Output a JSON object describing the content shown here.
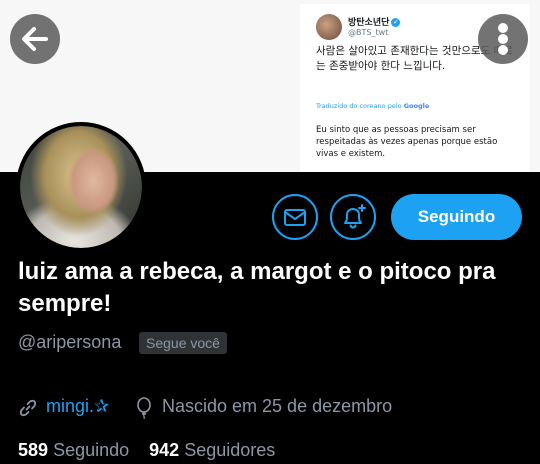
{
  "header_tweet": {
    "author_name": "방탄소년단",
    "author_handle": "@BTS_twt",
    "korean_text": "사람은 살아있고 존재한다는 것만으로도 때로는 존중받아야 한다 느낍니다.",
    "translated_label": "Traduzido do coreano pelo",
    "translated_brand": "Google",
    "portuguese_text": "Eu sinto que as pessoas precisam ser respeitadas às vezes apenas porque estão vivas e existem."
  },
  "nav": {
    "back_icon": "arrow-left-icon",
    "more_icon": "more-vertical-icon"
  },
  "actions": {
    "message_icon": "mail-icon",
    "notify_icon": "bell-plus-icon",
    "follow_label": "Seguindo"
  },
  "profile": {
    "display_name": "luiz ama a rebeca, a margot e o pitoco pra sempre!",
    "username": "@aripersona",
    "follows_you": "Segue você",
    "link_icon": "link-icon",
    "link_text": "mingi.✰",
    "birth_icon": "balloon-icon",
    "birth_text": "Nascido em 25 de dezembro",
    "following_count": "589",
    "following_label": "Seguindo",
    "followers_count": "942",
    "followers_label": "Seguidores"
  },
  "colors": {
    "accent": "#1da1f2",
    "background": "#000000",
    "secondary_text": "#8b98a5"
  }
}
